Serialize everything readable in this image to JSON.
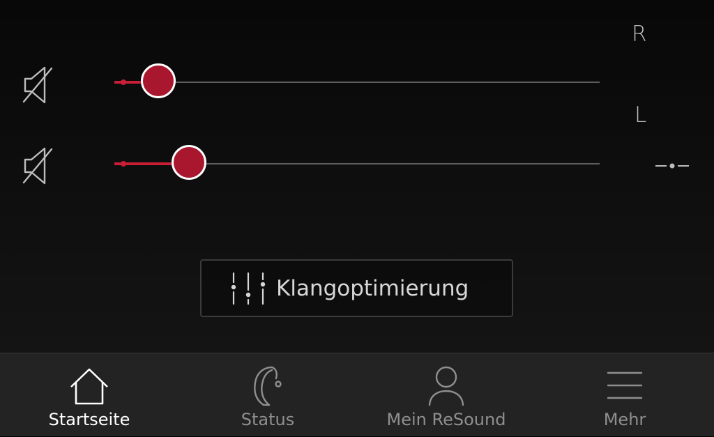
{
  "sides": {
    "right_label": "R",
    "left_label": "L"
  },
  "volume": {
    "right": {
      "level": 0.075,
      "mute_icon": "speaker-muted-icon"
    },
    "left": {
      "level": 0.14,
      "mute_icon": "speaker-muted-icon"
    },
    "link_icon": "link-sliders-icon"
  },
  "actions": {
    "sound_optimization": {
      "label": "Klangoptimierung",
      "icon": "equalizer-icon"
    }
  },
  "bottom_nav": {
    "items": [
      {
        "label": "Startseite",
        "icon": "home-icon",
        "active": true
      },
      {
        "label": "Status",
        "icon": "hearing-aid-icon",
        "active": false
      },
      {
        "label": "Mein ReSound",
        "icon": "user-icon",
        "active": false
      },
      {
        "label": "Mehr",
        "icon": "menu-icon",
        "active": false
      }
    ]
  },
  "colors": {
    "accent": "#c81e36",
    "thumb": "#a8172e",
    "background": "#0b0b0b",
    "nav_background": "#232323",
    "active_label": "#ffffff",
    "inactive_label": "#8f8f8f"
  }
}
